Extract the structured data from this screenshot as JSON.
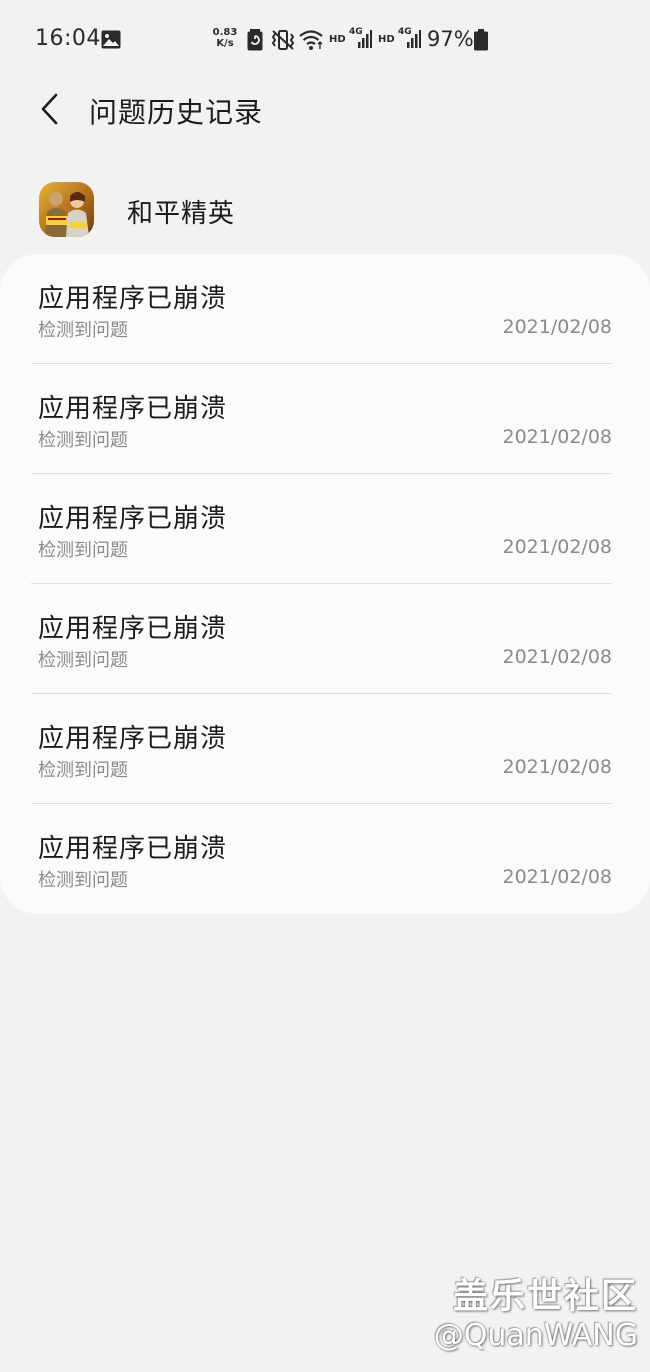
{
  "status_bar": {
    "time": "16:04",
    "speed_value": "0.83",
    "speed_unit": "K/s",
    "hd_1": "HD",
    "net_1": "4G",
    "hd_2": "HD",
    "net_2": "4G",
    "battery_percent": "97%",
    "icons": [
      "image-icon",
      "battery-saver-icon",
      "vibrate-icon",
      "wifi-icon",
      "signal-icon",
      "signal-icon",
      "battery-icon"
    ]
  },
  "header": {
    "back_icon": "chevron-left-icon",
    "title": "问题历史记录"
  },
  "app": {
    "icon": "game-app-icon",
    "name": "和平精英"
  },
  "history": {
    "items": [
      {
        "title": "应用程序已崩溃",
        "subtitle": "检测到问题",
        "date": "2021/02/08"
      },
      {
        "title": "应用程序已崩溃",
        "subtitle": "检测到问题",
        "date": "2021/02/08"
      },
      {
        "title": "应用程序已崩溃",
        "subtitle": "检测到问题",
        "date": "2021/02/08"
      },
      {
        "title": "应用程序已崩溃",
        "subtitle": "检测到问题",
        "date": "2021/02/08"
      },
      {
        "title": "应用程序已崩溃",
        "subtitle": "检测到问题",
        "date": "2021/02/08"
      },
      {
        "title": "应用程序已崩溃",
        "subtitle": "检测到问题",
        "date": "2021/02/08"
      }
    ]
  },
  "watermark": {
    "brand": "盖乐世社区",
    "user": "@QuanWANG"
  },
  "colors": {
    "background": "#f2f2f2",
    "card": "#fbfbfb",
    "primary_text": "#1c1c1c",
    "secondary_text": "#8a8a8a",
    "divider": "#dedede"
  }
}
